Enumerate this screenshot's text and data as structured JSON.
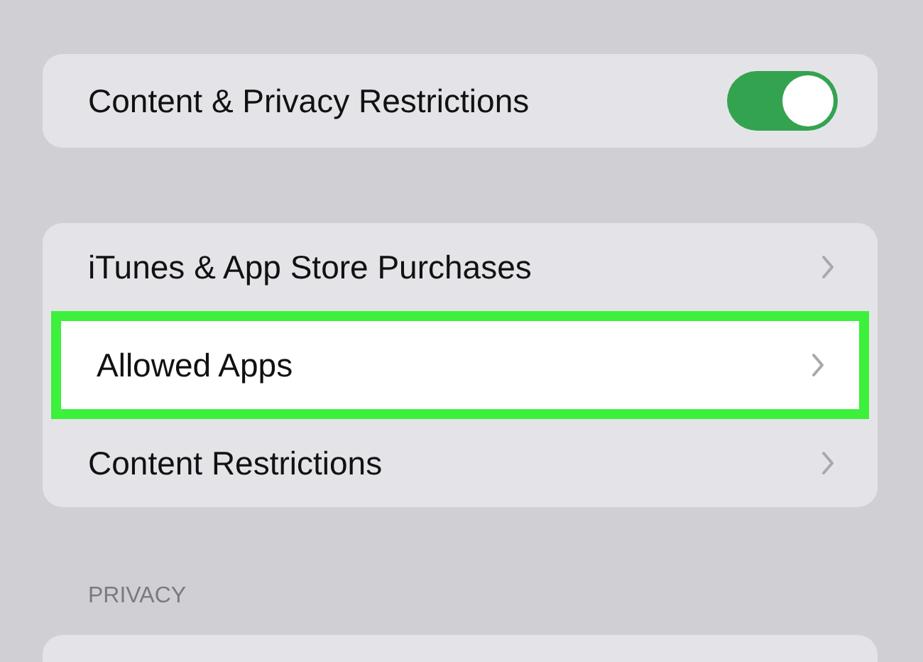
{
  "master_toggle": {
    "label": "Content & Privacy Restrictions",
    "on": true
  },
  "items": [
    {
      "label": "iTunes & App Store Purchases",
      "selected": false
    },
    {
      "label": "Allowed Apps",
      "selected": true
    },
    {
      "label": "Content Restrictions",
      "selected": false
    }
  ],
  "privacy_section": {
    "header": "PRIVACY"
  }
}
